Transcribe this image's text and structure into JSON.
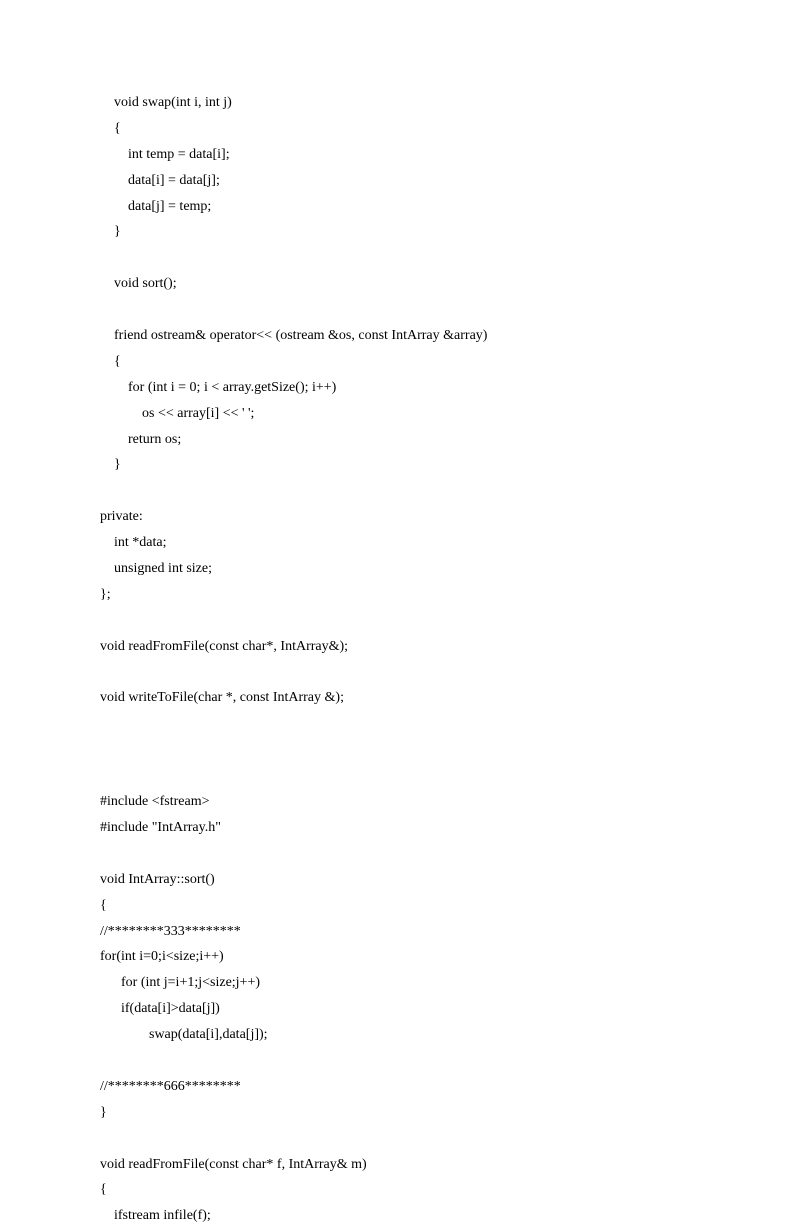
{
  "code": {
    "lines": [
      "    void swap(int i, int j)",
      "    {",
      "        int temp = data[i];",
      "        data[i] = data[j];",
      "        data[j] = temp;",
      "    }",
      "",
      "    void sort();",
      "",
      "    friend ostream& operator<< (ostream &os, const IntArray &array)",
      "    {",
      "        for (int i = 0; i < array.getSize(); i++)",
      "            os << array[i] << ' ';",
      "        return os;",
      "    }",
      "",
      "private:",
      "    int *data;",
      "    unsigned int size;",
      "};",
      "",
      "void readFromFile(const char*, IntArray&);",
      "",
      "void writeToFile(char *, const IntArray &);",
      "",
      "",
      "",
      "#include <fstream>",
      "#include \"IntArray.h\"",
      "",
      "void IntArray::sort()",
      "{",
      "//********333********",
      "for(int i=0;i<size;i++)",
      "      for (int j=i+1;j<size;j++)",
      "      if(data[i]>data[j])",
      "              swap(data[i],data[j]);",
      "",
      "//********666********",
      "}",
      "",
      "void readFromFile(const char* f, IntArray& m)",
      "{",
      "    ifstream infile(f);"
    ]
  }
}
